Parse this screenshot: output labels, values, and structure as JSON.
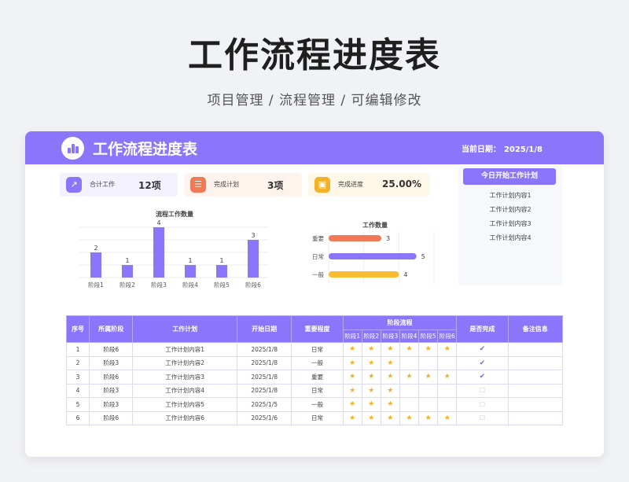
{
  "hero": {
    "title": "工作流程进度表",
    "subtitle": "项目管理 / 流程管理 / 可编辑修改"
  },
  "app": {
    "title": "工作流程进度表",
    "date_label": "当前日期：",
    "date_value": "2025/1/8",
    "accent": "#8b76fb"
  },
  "kpis": [
    {
      "label": "合计工作",
      "value": "12项",
      "icon": "chart-icon",
      "color": "#8b76fb",
      "bg": "#f4f2ff"
    },
    {
      "label": "完成计划",
      "value": "3项",
      "icon": "list-icon",
      "color": "#f07a55",
      "bg": "#fff3ee"
    },
    {
      "label": "完成进度",
      "value": "25.00%",
      "icon": "progress-icon",
      "color": "#f3b12a",
      "bg": "#fff8e8"
    }
  ],
  "chart_data": [
    {
      "type": "bar",
      "title": "流程工作数量",
      "categories": [
        "阶段1",
        "阶段2",
        "阶段3",
        "阶段4",
        "阶段5",
        "阶段6"
      ],
      "values": [
        2,
        1,
        4,
        1,
        1,
        3
      ],
      "ylim": [
        0,
        4
      ],
      "color": "#8b76fb",
      "grid": true
    },
    {
      "type": "bar",
      "orientation": "horizontal",
      "title": "工作数量",
      "categories": [
        "重要",
        "日常",
        "一般"
      ],
      "values": [
        3,
        5,
        4
      ],
      "colors": [
        "#f07a55",
        "#8b76fb",
        "#f7bd2f"
      ],
      "xlim": [
        0,
        6
      ],
      "grid": true
    }
  ],
  "today": {
    "header": "今日开始工作计划",
    "items": [
      "工作计划内容1",
      "工作计划内容2",
      "工作计划内容3",
      "工作计划内容4"
    ]
  },
  "table": {
    "headers": {
      "index": "序号",
      "stage": "所属阶段",
      "plan": "工作计划",
      "start": "开始日期",
      "importance": "重要程度",
      "flow": "阶段流程",
      "done": "是否完成",
      "note": "备注信息"
    },
    "stage_cols": [
      "阶段1",
      "阶段2",
      "阶段3",
      "阶段4",
      "阶段5",
      "阶段6"
    ],
    "rows": [
      {
        "index": "1",
        "stage": "阶段6",
        "plan": "工作计划内容1",
        "start": "2025/1/8",
        "importance": "日常",
        "stars": 6,
        "done": true,
        "note": ""
      },
      {
        "index": "2",
        "stage": "阶段3",
        "plan": "工作计划内容2",
        "start": "2025/1/8",
        "importance": "一般",
        "stars": 3,
        "done": true,
        "note": ""
      },
      {
        "index": "3",
        "stage": "阶段6",
        "plan": "工作计划内容3",
        "start": "2025/1/8",
        "importance": "重要",
        "stars": 6,
        "done": true,
        "note": ""
      },
      {
        "index": "4",
        "stage": "阶段3",
        "plan": "工作计划内容4",
        "start": "2025/1/8",
        "importance": "日常",
        "stars": 3,
        "done": false,
        "note": ""
      },
      {
        "index": "5",
        "stage": "阶段3",
        "plan": "工作计划内容5",
        "start": "2025/1/5",
        "importance": "一般",
        "stars": 3,
        "done": false,
        "note": ""
      },
      {
        "index": "6",
        "stage": "阶段6",
        "plan": "工作计划内容6",
        "start": "2025/1/6",
        "importance": "日常",
        "stars": 6,
        "done": false,
        "note": ""
      }
    ]
  }
}
